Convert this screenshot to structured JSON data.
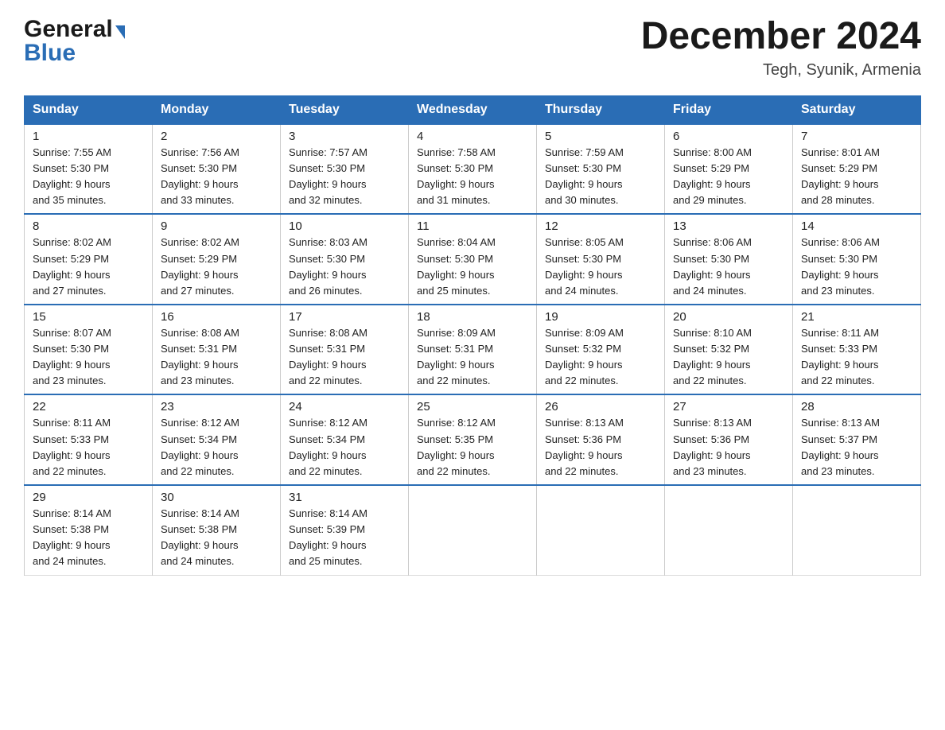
{
  "header": {
    "logo_line1": "General",
    "logo_line2": "Blue",
    "month_title": "December 2024",
    "location": "Tegh, Syunik, Armenia"
  },
  "days_of_week": [
    "Sunday",
    "Monday",
    "Tuesday",
    "Wednesday",
    "Thursday",
    "Friday",
    "Saturday"
  ],
  "weeks": [
    [
      {
        "day": "1",
        "sunrise": "7:55 AM",
        "sunset": "5:30 PM",
        "daylight": "9 hours and 35 minutes."
      },
      {
        "day": "2",
        "sunrise": "7:56 AM",
        "sunset": "5:30 PM",
        "daylight": "9 hours and 33 minutes."
      },
      {
        "day": "3",
        "sunrise": "7:57 AM",
        "sunset": "5:30 PM",
        "daylight": "9 hours and 32 minutes."
      },
      {
        "day": "4",
        "sunrise": "7:58 AM",
        "sunset": "5:30 PM",
        "daylight": "9 hours and 31 minutes."
      },
      {
        "day": "5",
        "sunrise": "7:59 AM",
        "sunset": "5:30 PM",
        "daylight": "9 hours and 30 minutes."
      },
      {
        "day": "6",
        "sunrise": "8:00 AM",
        "sunset": "5:29 PM",
        "daylight": "9 hours and 29 minutes."
      },
      {
        "day": "7",
        "sunrise": "8:01 AM",
        "sunset": "5:29 PM",
        "daylight": "9 hours and 28 minutes."
      }
    ],
    [
      {
        "day": "8",
        "sunrise": "8:02 AM",
        "sunset": "5:29 PM",
        "daylight": "9 hours and 27 minutes."
      },
      {
        "day": "9",
        "sunrise": "8:02 AM",
        "sunset": "5:29 PM",
        "daylight": "9 hours and 27 minutes."
      },
      {
        "day": "10",
        "sunrise": "8:03 AM",
        "sunset": "5:30 PM",
        "daylight": "9 hours and 26 minutes."
      },
      {
        "day": "11",
        "sunrise": "8:04 AM",
        "sunset": "5:30 PM",
        "daylight": "9 hours and 25 minutes."
      },
      {
        "day": "12",
        "sunrise": "8:05 AM",
        "sunset": "5:30 PM",
        "daylight": "9 hours and 24 minutes."
      },
      {
        "day": "13",
        "sunrise": "8:06 AM",
        "sunset": "5:30 PM",
        "daylight": "9 hours and 24 minutes."
      },
      {
        "day": "14",
        "sunrise": "8:06 AM",
        "sunset": "5:30 PM",
        "daylight": "9 hours and 23 minutes."
      }
    ],
    [
      {
        "day": "15",
        "sunrise": "8:07 AM",
        "sunset": "5:30 PM",
        "daylight": "9 hours and 23 minutes."
      },
      {
        "day": "16",
        "sunrise": "8:08 AM",
        "sunset": "5:31 PM",
        "daylight": "9 hours and 23 minutes."
      },
      {
        "day": "17",
        "sunrise": "8:08 AM",
        "sunset": "5:31 PM",
        "daylight": "9 hours and 22 minutes."
      },
      {
        "day": "18",
        "sunrise": "8:09 AM",
        "sunset": "5:31 PM",
        "daylight": "9 hours and 22 minutes."
      },
      {
        "day": "19",
        "sunrise": "8:09 AM",
        "sunset": "5:32 PM",
        "daylight": "9 hours and 22 minutes."
      },
      {
        "day": "20",
        "sunrise": "8:10 AM",
        "sunset": "5:32 PM",
        "daylight": "9 hours and 22 minutes."
      },
      {
        "day": "21",
        "sunrise": "8:11 AM",
        "sunset": "5:33 PM",
        "daylight": "9 hours and 22 minutes."
      }
    ],
    [
      {
        "day": "22",
        "sunrise": "8:11 AM",
        "sunset": "5:33 PM",
        "daylight": "9 hours and 22 minutes."
      },
      {
        "day": "23",
        "sunrise": "8:12 AM",
        "sunset": "5:34 PM",
        "daylight": "9 hours and 22 minutes."
      },
      {
        "day": "24",
        "sunrise": "8:12 AM",
        "sunset": "5:34 PM",
        "daylight": "9 hours and 22 minutes."
      },
      {
        "day": "25",
        "sunrise": "8:12 AM",
        "sunset": "5:35 PM",
        "daylight": "9 hours and 22 minutes."
      },
      {
        "day": "26",
        "sunrise": "8:13 AM",
        "sunset": "5:36 PM",
        "daylight": "9 hours and 22 minutes."
      },
      {
        "day": "27",
        "sunrise": "8:13 AM",
        "sunset": "5:36 PM",
        "daylight": "9 hours and 23 minutes."
      },
      {
        "day": "28",
        "sunrise": "8:13 AM",
        "sunset": "5:37 PM",
        "daylight": "9 hours and 23 minutes."
      }
    ],
    [
      {
        "day": "29",
        "sunrise": "8:14 AM",
        "sunset": "5:38 PM",
        "daylight": "9 hours and 24 minutes."
      },
      {
        "day": "30",
        "sunrise": "8:14 AM",
        "sunset": "5:38 PM",
        "daylight": "9 hours and 24 minutes."
      },
      {
        "day": "31",
        "sunrise": "8:14 AM",
        "sunset": "5:39 PM",
        "daylight": "9 hours and 25 minutes."
      },
      null,
      null,
      null,
      null
    ]
  ],
  "labels": {
    "sunrise": "Sunrise: ",
    "sunset": "Sunset: ",
    "daylight": "Daylight: "
  }
}
